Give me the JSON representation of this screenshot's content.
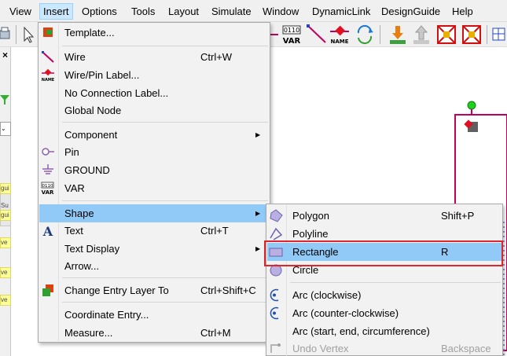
{
  "menubar": {
    "items": [
      "View",
      "Insert",
      "Options",
      "Tools",
      "Layout",
      "Simulate",
      "Window",
      "DynamicLink",
      "DesignGuide",
      "Help"
    ],
    "active": "Insert"
  },
  "toolbar": {
    "var_text": "0110\nVAR",
    "name_text": "NAME"
  },
  "insert_menu": {
    "template": "Template...",
    "wire": "Wire",
    "wire_sc": "Ctrl+W",
    "wire_pin_label": "Wire/Pin Label...",
    "no_connection_label": "No Connection Label...",
    "global_node": "Global Node",
    "component": "Component",
    "pin": "Pin",
    "ground": "GROUND",
    "var": "VAR",
    "shape": "Shape",
    "text": "Text",
    "text_sc": "Ctrl+T",
    "text_display": "Text Display",
    "arrow": "Arrow...",
    "change_entry_layer": "Change Entry Layer To",
    "change_entry_layer_sc": "Ctrl+Shift+C",
    "coordinate_entry": "Coordinate Entry...",
    "measure": "Measure...",
    "measure_sc": "Ctrl+M"
  },
  "shape_menu": {
    "polygon": "Polygon",
    "polygon_sc": "Shift+P",
    "polyline": "Polyline",
    "rectangle": "Rectangle",
    "rectangle_sc": "R",
    "circle": "Circle",
    "arc_cw": "Arc (clockwise)",
    "arc_ccw": "Arc (counter-clockwise)",
    "arc_sec": "Arc (start, end, circumference)",
    "undo_vertex": "Undo Vertex",
    "undo_vertex_sc": "Backspace"
  },
  "left_panel": {
    "close": "×",
    "su": "Su",
    "tags": [
      "gui",
      "gui",
      "ve",
      "ve",
      "ve"
    ]
  },
  "colors": {
    "highlight": "#91c9f7",
    "red_box": "#e0242c",
    "wire": "#c00060"
  }
}
